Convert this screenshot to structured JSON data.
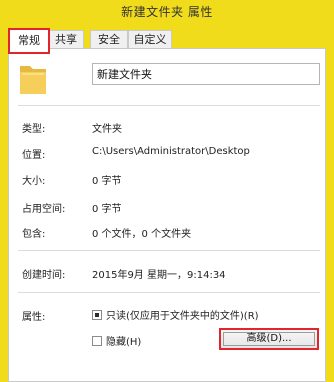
{
  "window": {
    "title": "新建文件夹 属性"
  },
  "tabs": [
    {
      "label": "常规",
      "active": true
    },
    {
      "label": "共享",
      "active": false
    },
    {
      "label": "安全",
      "active": false
    },
    {
      "label": "自定义",
      "active": false
    }
  ],
  "folder": {
    "name": "新建文件夹",
    "icon": "folder-icon"
  },
  "info": {
    "type_label": "类型:",
    "type_value": "文件夹",
    "location_label": "位置:",
    "location_value": "C:\\Users\\Administrator\\Desktop",
    "size_label": "大小:",
    "size_value": "0 字节",
    "disk_label": "占用空间:",
    "disk_value": "0 字节",
    "contains_label": "包含:",
    "contains_value": "0 个文件，0 个文件夹",
    "created_label": "创建时间:",
    "created_value": "2015年9月 星期一，9:14:34"
  },
  "attributes": {
    "label": "属性:",
    "readonly_label": "只读(仅应用于文件夹中的文件)(R)",
    "readonly_checked": true,
    "hidden_label": "隐藏(H)",
    "hidden_checked": false,
    "advanced_button": "高级(D)..."
  },
  "colors": {
    "titlebar": "#f1dc1c",
    "highlight": "#e0262b",
    "folder": "#f5cf5a"
  }
}
